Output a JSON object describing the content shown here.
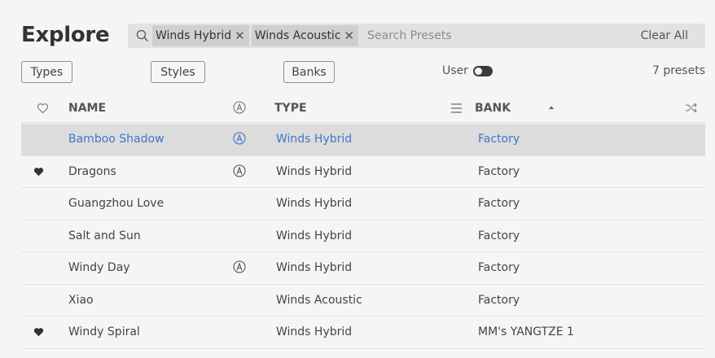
{
  "header": {
    "title": "Explore"
  },
  "search": {
    "chips": [
      {
        "label": "Winds Hybrid",
        "remove": "✕"
      },
      {
        "label": "Winds Acoustic",
        "remove": "✕"
      }
    ],
    "placeholder": "Search Presets",
    "clear_label": "Clear All"
  },
  "filters": {
    "types": "Types",
    "styles": "Styles",
    "banks": "Banks",
    "user_label": "User",
    "user_enabled": true,
    "count_text": "7 presets"
  },
  "columns": {
    "name": "NAME",
    "type": "TYPE",
    "bank": "BANK"
  },
  "rows": [
    {
      "name": "Bamboo Shadow",
      "type": "Winds Hybrid",
      "bank": "Factory",
      "liked": false,
      "arp": true,
      "selected": true
    },
    {
      "name": "Dragons",
      "type": "Winds Hybrid",
      "bank": "Factory",
      "liked": true,
      "arp": true,
      "selected": false
    },
    {
      "name": "Guangzhou Love",
      "type": "Winds Hybrid",
      "bank": "Factory",
      "liked": false,
      "arp": false,
      "selected": false
    },
    {
      "name": "Salt and Sun",
      "type": "Winds Hybrid",
      "bank": "Factory",
      "liked": false,
      "arp": false,
      "selected": false
    },
    {
      "name": "Windy Day",
      "type": "Winds Hybrid",
      "bank": "Factory",
      "liked": false,
      "arp": true,
      "selected": false
    },
    {
      "name": "Xiao",
      "type": "Winds Acoustic",
      "bank": "Factory",
      "liked": false,
      "arp": false,
      "selected": false
    },
    {
      "name": "Windy Spiral",
      "type": "Winds Hybrid",
      "bank": "MM's YANGTZE 1",
      "liked": true,
      "arp": false,
      "selected": false
    }
  ],
  "icons": {
    "search": "search-icon",
    "heart_header": "heart-outline-icon",
    "arp_header": "circle-a-icon",
    "menu": "hamburger-menu-icon",
    "sort": "sort-ascending-icon",
    "shuffle": "shuffle-icon",
    "heart_filled": "heart-filled-icon"
  },
  "colors": {
    "selected_text": "#3e78c7",
    "selected_bg": "#dcdcdc",
    "background": "#f5f5f5"
  }
}
